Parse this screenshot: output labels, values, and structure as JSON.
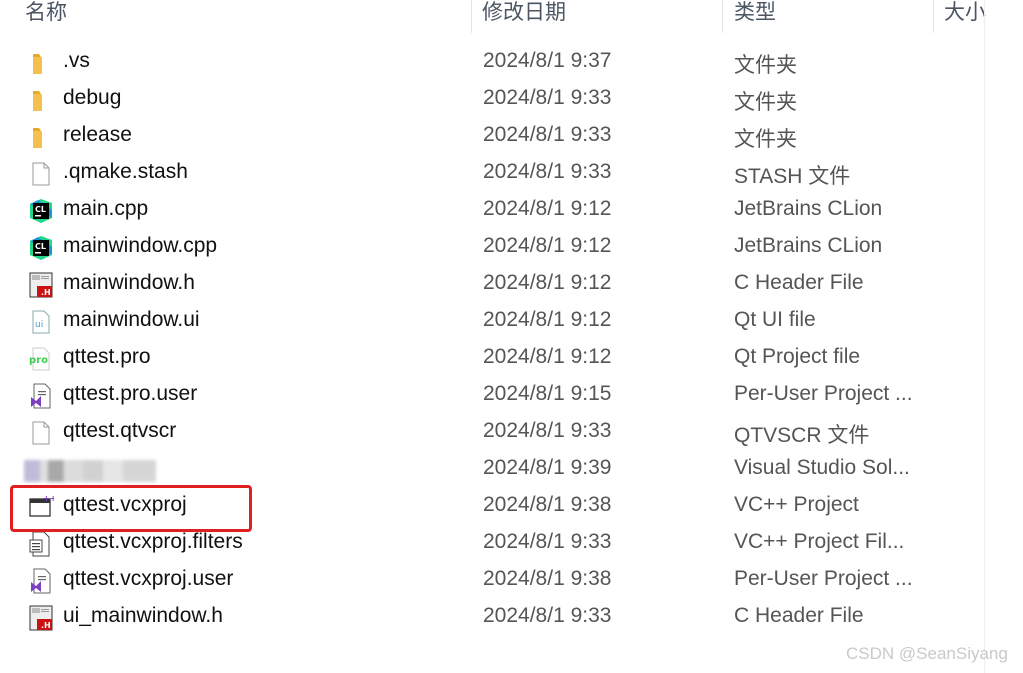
{
  "columns": {
    "name": "名称",
    "date": "修改日期",
    "type": "类型",
    "size": "大小"
  },
  "files": [
    {
      "name": ".vs",
      "date": "2024/8/1 9:37",
      "type": "文件夹",
      "icon": "folder-icon"
    },
    {
      "name": "debug",
      "date": "2024/8/1 9:33",
      "type": "文件夹",
      "icon": "folder-icon"
    },
    {
      "name": "release",
      "date": "2024/8/1 9:33",
      "type": "文件夹",
      "icon": "folder-icon"
    },
    {
      "name": ".qmake.stash",
      "date": "2024/8/1 9:33",
      "type": "STASH 文件",
      "icon": "blank-file-icon"
    },
    {
      "name": "main.cpp",
      "date": "2024/8/1 9:12",
      "type": "JetBrains CLion",
      "icon": "clion-icon"
    },
    {
      "name": "mainwindow.cpp",
      "date": "2024/8/1 9:12",
      "type": "JetBrains CLion",
      "icon": "clion-icon"
    },
    {
      "name": "mainwindow.h",
      "date": "2024/8/1 9:12",
      "type": "C Header File",
      "icon": "c-header-icon"
    },
    {
      "name": "mainwindow.ui",
      "date": "2024/8/1 9:12",
      "type": "Qt UI file",
      "icon": "qt-ui-icon"
    },
    {
      "name": "qttest.pro",
      "date": "2024/8/1 9:12",
      "type": "Qt Project file",
      "icon": "qt-pro-icon"
    },
    {
      "name": "qttest.pro.user",
      "date": "2024/8/1 9:15",
      "type": "Per-User Project ...",
      "icon": "vs-user-icon"
    },
    {
      "name": "qttest.qtvscr",
      "date": "2024/8/1 9:33",
      "type": "QTVSCR 文件",
      "icon": "blank-file-icon"
    },
    {
      "name": "",
      "date": "2024/8/1 9:39",
      "type": "Visual Studio Sol...",
      "icon": "blurred-icon"
    },
    {
      "name": "qttest.vcxproj",
      "date": "2024/8/1 9:38",
      "type": "VC++ Project",
      "icon": "vcxproj-icon"
    },
    {
      "name": "qttest.vcxproj.filters",
      "date": "2024/8/1 9:33",
      "type": "VC++ Project Fil...",
      "icon": "filters-icon"
    },
    {
      "name": "qttest.vcxproj.user",
      "date": "2024/8/1 9:38",
      "type": "Per-User Project ...",
      "icon": "vs-user-icon"
    },
    {
      "name": "ui_mainwindow.h",
      "date": "2024/8/1 9:33",
      "type": "C Header File",
      "icon": "c-header-icon"
    }
  ],
  "watermark": "CSDN @SeanSiyang",
  "colors": {
    "highlight": "#e02020",
    "folder": "#f4c14f",
    "clion": "#21d789"
  }
}
